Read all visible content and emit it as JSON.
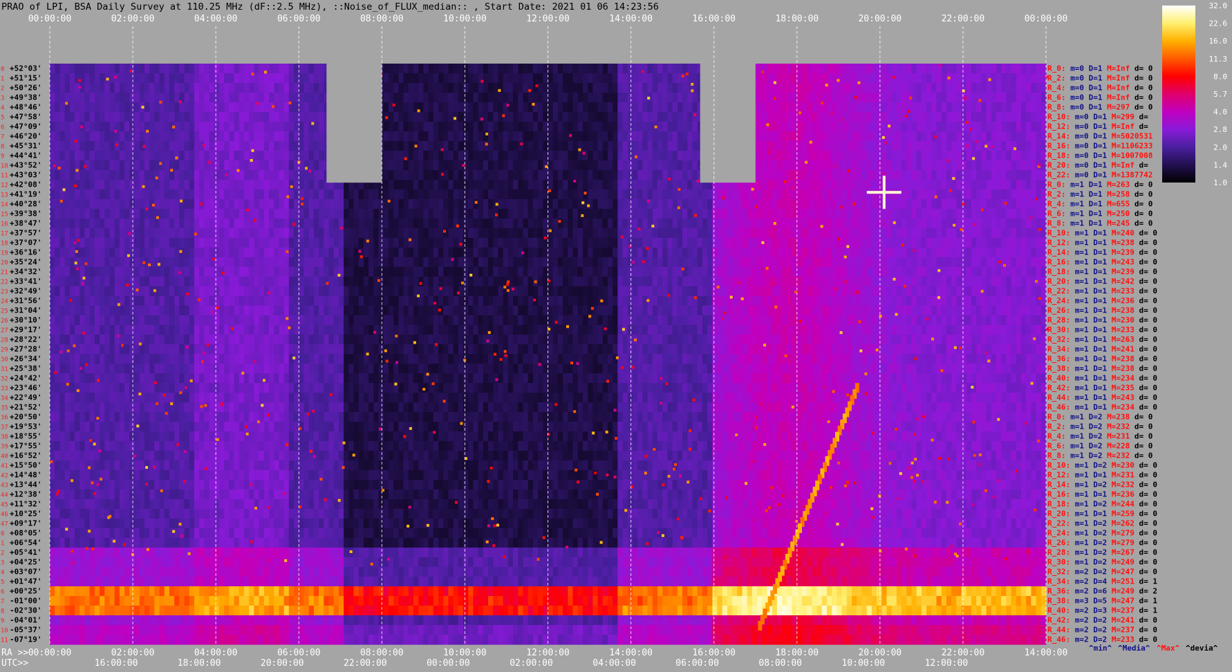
{
  "chart_data": {
    "type": "heatmap",
    "title": "PRAO of LPI, BSA Daily Survey at 110.25 MHz (dF::2.5 MHz), ::Noise_of_FLUX_median:: , Start Date: 2021 01 06 14:23:56",
    "x_utc_ticks": [
      "00:00:00",
      "02:00:00",
      "04:00:00",
      "06:00:00",
      "08:00:00",
      "10:00:00",
      "12:00:00",
      "14:00:00",
      "16:00:00",
      "18:00:00",
      "20:00:00",
      "22:00:00",
      "00:00:00"
    ],
    "x_ra_ticks": [
      "00:00:00",
      "02:00:00",
      "04:00:00",
      "06:00:00",
      "08:00:00",
      "10:00:00",
      "12:00:00",
      "14:00:00",
      "16:00:00",
      "18:00:00",
      "20:00:00",
      "22:00:00",
      "14:00:00"
    ],
    "x_utc_bottom_ticks": [
      "16:00:00",
      "18:00:00",
      "20:00:00",
      "22:00:00",
      "00:00:00",
      "02:00:00",
      "04:00:00",
      "06:00:00",
      "08:00:00",
      "10:00:00",
      "12:00:00"
    ],
    "ra_prefix": "RA >>",
    "utc_prefix": "UTC>>",
    "y_ticks": [
      "+52°03'",
      "+51°15'",
      "+50°26'",
      "+49°38'",
      "+48°46'",
      "+47°58'",
      "+47°09'",
      "+46°20'",
      "+45°31'",
      "+44°41'",
      "+43°52'",
      "+43°03'",
      "+42°08'",
      "+41°19'",
      "+40°28'",
      "+39°38'",
      "+38°47'",
      "+37°57'",
      "+37°07'",
      "+36°16'",
      "+35°24'",
      "+34°32'",
      "+33°41'",
      "+32°49'",
      "+31°56'",
      "+31°04'",
      "+30°10'",
      "+29°17'",
      "+28°22'",
      "+27°28'",
      "+26°34'",
      "+25°38'",
      "+24°42'",
      "+23°46'",
      "+22°49'",
      "+21°52'",
      "+20°50'",
      "+19°53'",
      "+18°55'",
      "+17°55'",
      "+16°52'",
      "+15°50'",
      "+14°48'",
      "+13°44'",
      "+12°38'",
      "+11°32'",
      "+10°25'",
      "+09°17'",
      "+08°05'",
      "+06°54'",
      "+05°41'",
      "+04°25'",
      "+03°07'",
      "+01°47'",
      "+00°25'",
      "-01°00'",
      "-02°30'",
      "-04°01'",
      "-05°37'",
      "-07°19'"
    ],
    "colorbar": {
      "ticks": [
        "32.0",
        "22.6",
        "16.0",
        "11.3",
        "8.0",
        "5.7",
        "4.0",
        "2.8",
        "2.0",
        "1.4",
        "1.0"
      ],
      "colors": [
        "#ffffff",
        "#fff070",
        "#ffb000",
        "#ff5a00",
        "#ff0000",
        "#e0006a",
        "#c000c0",
        "#8a1ad8",
        "#4a1fa0",
        "#231050",
        "#000000"
      ]
    },
    "row_stats": [
      {
        "r": "R_0:",
        "m": "m=0",
        "d": "D=1",
        "mx": "M=Inf",
        "dv": "d= 0"
      },
      {
        "r": "R_2:",
        "m": "m=0",
        "d": "D=1",
        "mx": "M=Inf",
        "dv": "d= 0"
      },
      {
        "r": "R_4:",
        "m": "m=0",
        "d": "D=1",
        "mx": "M=Inf",
        "dv": "d= 0"
      },
      {
        "r": "R_6:",
        "m": "m=0",
        "d": "D=1",
        "mx": "M=Inf",
        "dv": "d= 0"
      },
      {
        "r": "R_8:",
        "m": "m=0",
        "d": "D=1",
        "mx": "M=297",
        "dv": "d= 0"
      },
      {
        "r": "R_10:",
        "m": "m=0",
        "d": "D=1",
        "mx": "M=299",
        "dv": "d="
      },
      {
        "r": "R_12:",
        "m": "m=0",
        "d": "D=1",
        "mx": "M=Inf",
        "dv": "d="
      },
      {
        "r": "R_14:",
        "m": "m=0",
        "d": "D=1",
        "mx": "M=5020531",
        "dv": ""
      },
      {
        "r": "R_16:",
        "m": "m=0",
        "d": "D=1",
        "mx": "M=1106233",
        "dv": ""
      },
      {
        "r": "R_18:",
        "m": "m=0",
        "d": "D=1",
        "mx": "M=1007008",
        "dv": ""
      },
      {
        "r": "R_20:",
        "m": "m=0",
        "d": "D=1",
        "mx": "M=Inf",
        "dv": "d="
      },
      {
        "r": "R_22:",
        "m": "m=0",
        "d": "D=1",
        "mx": "M=1387742",
        "dv": ""
      },
      {
        "r": "R_0:",
        "m": "m=1",
        "d": "D=1",
        "mx": "M=263",
        "dv": "d= 0"
      },
      {
        "r": "R_2:",
        "m": "m=1",
        "d": "D=1",
        "mx": "M=258",
        "dv": "d= 0"
      },
      {
        "r": "R_4:",
        "m": "m=1",
        "d": "D=1",
        "mx": "M=655",
        "dv": "d= 0"
      },
      {
        "r": "R_6:",
        "m": "m=1",
        "d": "D=1",
        "mx": "M=250",
        "dv": "d= 0"
      },
      {
        "r": "R_8:",
        "m": "m=1",
        "d": "D=1",
        "mx": "M=245",
        "dv": "d= 0"
      },
      {
        "r": "R_10:",
        "m": "m=1",
        "d": "D=1",
        "mx": "M=240",
        "dv": "d= 0"
      },
      {
        "r": "R_12:",
        "m": "m=1",
        "d": "D=1",
        "mx": "M=238",
        "dv": "d= 0"
      },
      {
        "r": "R_14:",
        "m": "m=1",
        "d": "D=1",
        "mx": "M=239",
        "dv": "d= 0"
      },
      {
        "r": "R_16:",
        "m": "m=1",
        "d": "D=1",
        "mx": "M=243",
        "dv": "d= 0"
      },
      {
        "r": "R_18:",
        "m": "m=1",
        "d": "D=1",
        "mx": "M=239",
        "dv": "d= 0"
      },
      {
        "r": "R_20:",
        "m": "m=1",
        "d": "D=1",
        "mx": "M=242",
        "dv": "d= 0"
      },
      {
        "r": "R_22:",
        "m": "m=1",
        "d": "D=1",
        "mx": "M=233",
        "dv": "d= 0"
      },
      {
        "r": "R_24:",
        "m": "m=1",
        "d": "D=1",
        "mx": "M=236",
        "dv": "d= 0"
      },
      {
        "r": "R_26:",
        "m": "m=1",
        "d": "D=1",
        "mx": "M=238",
        "dv": "d= 0"
      },
      {
        "r": "R_28:",
        "m": "m=1",
        "d": "D=1",
        "mx": "M=230",
        "dv": "d= 0"
      },
      {
        "r": "R_30:",
        "m": "m=1",
        "d": "D=1",
        "mx": "M=233",
        "dv": "d= 0"
      },
      {
        "r": "R_32:",
        "m": "m=1",
        "d": "D=1",
        "mx": "M=263",
        "dv": "d= 0"
      },
      {
        "r": "R_34:",
        "m": "m=1",
        "d": "D=1",
        "mx": "M=241",
        "dv": "d= 0"
      },
      {
        "r": "R_36:",
        "m": "m=1",
        "d": "D=1",
        "mx": "M=238",
        "dv": "d= 0"
      },
      {
        "r": "R_38:",
        "m": "m=1",
        "d": "D=1",
        "mx": "M=238",
        "dv": "d= 0"
      },
      {
        "r": "R_40:",
        "m": "m=1",
        "d": "D=1",
        "mx": "M=234",
        "dv": "d= 0"
      },
      {
        "r": "R_42:",
        "m": "m=1",
        "d": "D=1",
        "mx": "M=235",
        "dv": "d= 0"
      },
      {
        "r": "R_44:",
        "m": "m=1",
        "d": "D=1",
        "mx": "M=243",
        "dv": "d= 0"
      },
      {
        "r": "R_46:",
        "m": "m=1",
        "d": "D=1",
        "mx": "M=234",
        "dv": "d= 0"
      },
      {
        "r": "R_0:",
        "m": "m=1",
        "d": "D=2",
        "mx": "M=238",
        "dv": "d= 0"
      },
      {
        "r": "R_2:",
        "m": "m=1",
        "d": "D=2",
        "mx": "M=232",
        "dv": "d= 0"
      },
      {
        "r": "R_4:",
        "m": "m=1",
        "d": "D=2",
        "mx": "M=231",
        "dv": "d= 0"
      },
      {
        "r": "R_6:",
        "m": "m=1",
        "d": "D=2",
        "mx": "M=228",
        "dv": "d= 0"
      },
      {
        "r": "R_8:",
        "m": "m=1",
        "d": "D=2",
        "mx": "M=232",
        "dv": "d= 0"
      },
      {
        "r": "R_10:",
        "m": "m=1",
        "d": "D=2",
        "mx": "M=230",
        "dv": "d= 0"
      },
      {
        "r": "R_12:",
        "m": "m=1",
        "d": "D=1",
        "mx": "M=231",
        "dv": "d= 0"
      },
      {
        "r": "R_14:",
        "m": "m=1",
        "d": "D=2",
        "mx": "M=232",
        "dv": "d= 0"
      },
      {
        "r": "R_16:",
        "m": "m=1",
        "d": "D=1",
        "mx": "M=236",
        "dv": "d= 0"
      },
      {
        "r": "R_18:",
        "m": "m=1",
        "d": "D=2",
        "mx": "M=244",
        "dv": "d= 0"
      },
      {
        "r": "R_20:",
        "m": "m=1",
        "d": "D=1",
        "mx": "M=259",
        "dv": "d= 0"
      },
      {
        "r": "R_22:",
        "m": "m=1",
        "d": "D=2",
        "mx": "M=262",
        "dv": "d= 0"
      },
      {
        "r": "R_24:",
        "m": "m=1",
        "d": "D=2",
        "mx": "M=279",
        "dv": "d= 0"
      },
      {
        "r": "R_26:",
        "m": "m=1",
        "d": "D=2",
        "mx": "M=279",
        "dv": "d= 0"
      },
      {
        "r": "R_28:",
        "m": "m=1",
        "d": "D=2",
        "mx": "M=267",
        "dv": "d= 0"
      },
      {
        "r": "R_30:",
        "m": "m=1",
        "d": "D=2",
        "mx": "M=249",
        "dv": "d= 0"
      },
      {
        "r": "R_32:",
        "m": "m=2",
        "d": "D=2",
        "mx": "M=247",
        "dv": "d= 0"
      },
      {
        "r": "R_34:",
        "m": "m=2",
        "d": "D=4",
        "mx": "M=251",
        "dv": "d= 1"
      },
      {
        "r": "R_36:",
        "m": "m=2",
        "d": "D=6",
        "mx": "M=249",
        "dv": "d= 2"
      },
      {
        "r": "R_38:",
        "m": "m=3",
        "d": "D=5",
        "mx": "M=247",
        "dv": "d= 1"
      },
      {
        "r": "R_40:",
        "m": "m=2",
        "d": "D=3",
        "mx": "M=237",
        "dv": "d= 1"
      },
      {
        "r": "R_42:",
        "m": "m=2",
        "d": "D=2",
        "mx": "M=241",
        "dv": "d= 0"
      },
      {
        "r": "R_44:",
        "m": "m=2",
        "d": "D=2",
        "mx": "M=237",
        "dv": "d= 0"
      },
      {
        "r": "R_46:",
        "m": "m=2",
        "d": "D=2",
        "mx": "M=233",
        "dv": "d= 0"
      }
    ],
    "legend_labels": [
      {
        "text": "^min^",
        "color": "#10108a"
      },
      {
        "text": "^Media^",
        "color": "#10108a"
      },
      {
        "text": "^Max^",
        "color": "#ff1010"
      },
      {
        "text": "^devia^",
        "color": "#000000"
      }
    ],
    "gaps_utc": [
      [
        "06:40:00",
        "08:00:00"
      ],
      [
        "15:40:00",
        "17:00:00"
      ]
    ],
    "features": [
      "bright horizontal band near declination +00°25' (Sun/galactic plane)",
      "bright drifting streak near 18:40–19:30 UTC",
      "bright source near 20:00 UTC at +41°19'"
    ]
  }
}
